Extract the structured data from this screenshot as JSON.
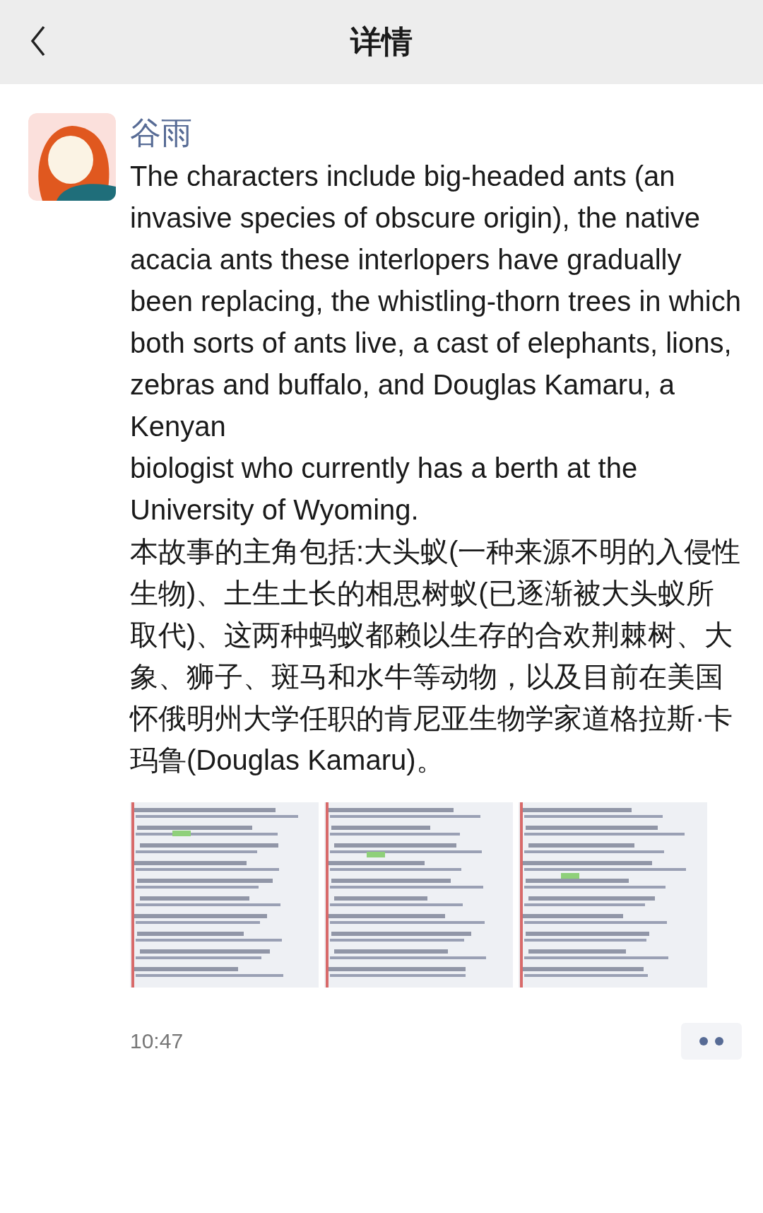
{
  "header": {
    "title": "详情"
  },
  "post": {
    "author": "谷雨",
    "text": "The characters include big-headed ants (an invasive species of obscure origin), the native acacia ants these interlopers have gradually been replacing, the whistling-thorn trees in which both sorts of ants live, a cast of elephants, lions, zebras and buffalo, and Douglas Kamaru, a Kenyan\nbiologist who currently has a berth at the University of Wyoming.\n本故事的主角包括:大头蚁(一种来源不明的入侵性生物)、土生土长的相思树蚁(已逐渐被大头蚁所取代)、这两种蚂蚁都赖以生存的合欢荆棘树、大象、狮子、斑马和水牛等动物，以及目前在美国怀俄明州大学任职的肯尼亚生物学家道格拉斯·卡玛鲁(Douglas Kamaru)。",
    "time": "10:47"
  }
}
